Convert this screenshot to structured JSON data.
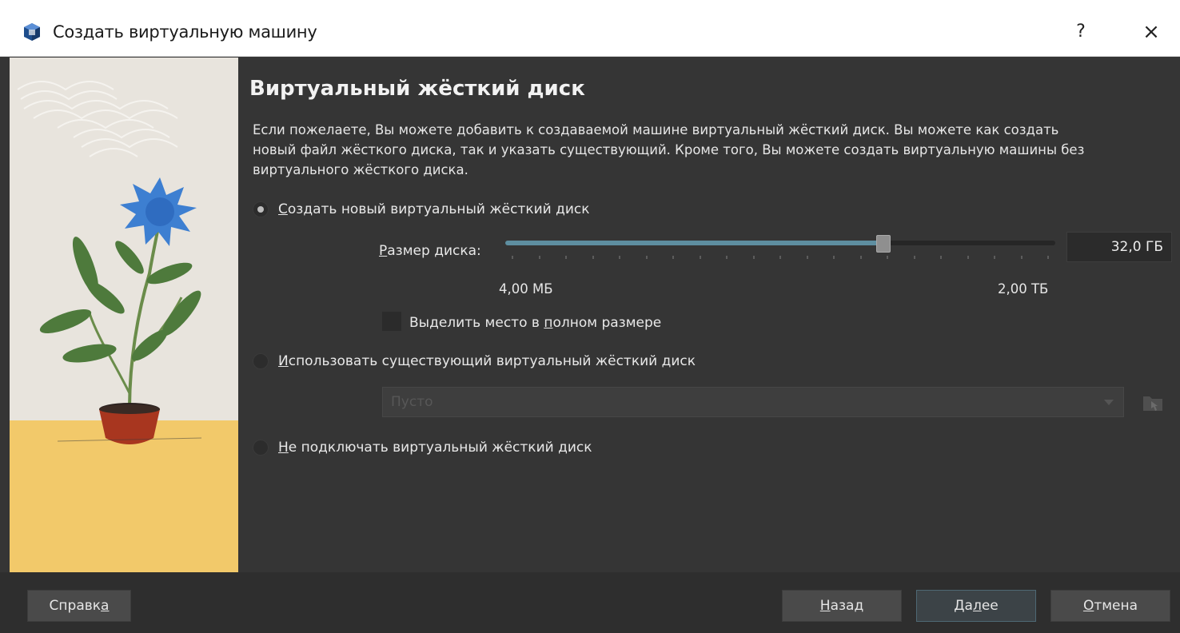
{
  "window": {
    "title": "Создать виртуальную машину",
    "help_label": "?",
    "close_label": "×"
  },
  "page": {
    "heading": "Виртуальный жёсткий диск",
    "description": "Если пожелаете, Вы можете добавить к создаваемой машине виртуальный жёсткий диск. Вы можете как создать новый файл жёсткого диска, так и указать существующий. Кроме того, Вы можете создать виртуальную машины без виртуального жёсткого диска."
  },
  "options": {
    "create_new": {
      "label_accel": "С",
      "label_rest": "оздать новый виртуальный жёсткий диск",
      "selected": true
    },
    "use_existing": {
      "label_accel": "И",
      "label_rest": "спользовать существующий виртуальный жёсткий диск",
      "selected": false
    },
    "no_disk": {
      "label_accel": "Н",
      "label_rest": "е подключать виртуальный жёсткий диск",
      "selected": false
    }
  },
  "disk_size": {
    "label_accel": "Р",
    "label_rest": "азмер диска:",
    "value": "32,0 ГБ",
    "min_label": "4,00 МБ",
    "max_label": "2,00 ТБ",
    "slider_fraction": 0.69,
    "tick_count": 20
  },
  "preallocate": {
    "label_before": "Выделить место в ",
    "label_accel": "п",
    "label_after": "олном размере",
    "checked": false
  },
  "existing_disk": {
    "selected_value": "Пусто",
    "enabled": false
  },
  "buttons": {
    "help": {
      "label_before": "Справк",
      "label_accel": "а",
      "label_after": ""
    },
    "back": {
      "label_before": "",
      "label_accel": "Н",
      "label_after": "азад"
    },
    "next": {
      "label_before": "Да",
      "label_accel": "л",
      "label_after": "ее"
    },
    "cancel": {
      "label_before": "",
      "label_accel": "О",
      "label_after": "тмена"
    }
  },
  "colors": {
    "background": "#353535",
    "footer": "#2e2e2e",
    "slider_fill": "#5e8ea0",
    "illustration_yellow": "#f2c96a",
    "flower_blue": "#3d7fd1",
    "pot_red": "#a8361f"
  }
}
